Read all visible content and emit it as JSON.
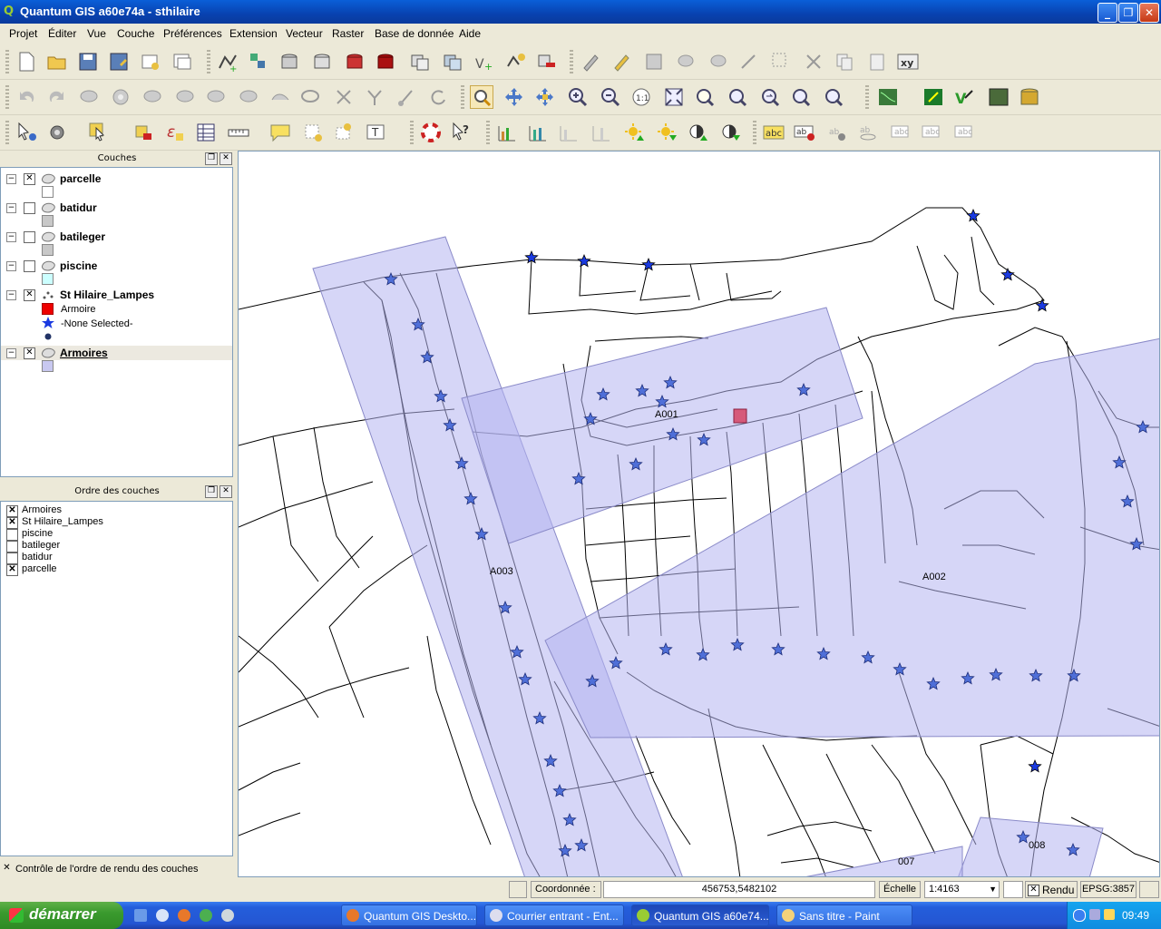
{
  "window": {
    "title": "Quantum GIS a60e74a - sthilaire",
    "min_label": "_",
    "max_label": "❐",
    "close_label": "✕"
  },
  "menu": [
    "Projet",
    "Éditer",
    "Vue",
    "Couche",
    "Préférences",
    "Extension",
    "Vecteur",
    "Raster",
    "Base de donnée",
    "Aide"
  ],
  "layers_panel": {
    "title": "Couches",
    "layers": [
      {
        "name": "parcelle",
        "checked": true,
        "swatch": "#ffffff"
      },
      {
        "name": "batidur",
        "checked": false,
        "swatch": "#c8c8c8"
      },
      {
        "name": "batileger",
        "checked": false,
        "swatch": "#c8c8c8"
      },
      {
        "name": "piscine",
        "checked": false,
        "swatch": "#ccffff"
      },
      {
        "name": "St Hilaire_Lampes",
        "checked": true,
        "legend": [
          "Armoire",
          "-None Selected-"
        ]
      },
      {
        "name": "Armoires",
        "checked": true,
        "swatch": "#c8c8f0"
      }
    ]
  },
  "order_panel": {
    "title": "Ordre des couches",
    "items": [
      {
        "name": "Armoires",
        "checked": true
      },
      {
        "name": "St Hilaire_Lampes",
        "checked": true
      },
      {
        "name": "piscine",
        "checked": false
      },
      {
        "name": "batileger",
        "checked": false
      },
      {
        "name": "batidur",
        "checked": false
      },
      {
        "name": "parcelle",
        "checked": true
      }
    ],
    "control_label": "Contrôle de l'ordre de rendu des couches",
    "control_checked": true
  },
  "map": {
    "labels": [
      "A001",
      "A002",
      "A003",
      "007",
      "008"
    ],
    "colors": {
      "zone_fill": "#b4b4f0",
      "lamp": "#4f6fd8",
      "armoire": "#d65a7a"
    }
  },
  "status": {
    "coord_label": "Coordonnée :",
    "coord_value": "456753,5482102",
    "scale_label": "Échelle",
    "scale_value": "1:4163",
    "render_label": "Rendu",
    "epsg": "EPSG:3857"
  },
  "taskbar": {
    "start": "démarrer",
    "tasks": [
      "Quantum GIS Deskto...",
      "Courrier entrant - Ent...",
      "Quantum GIS a60e74...",
      "Sans titre - Paint"
    ],
    "clock": "09:49"
  }
}
